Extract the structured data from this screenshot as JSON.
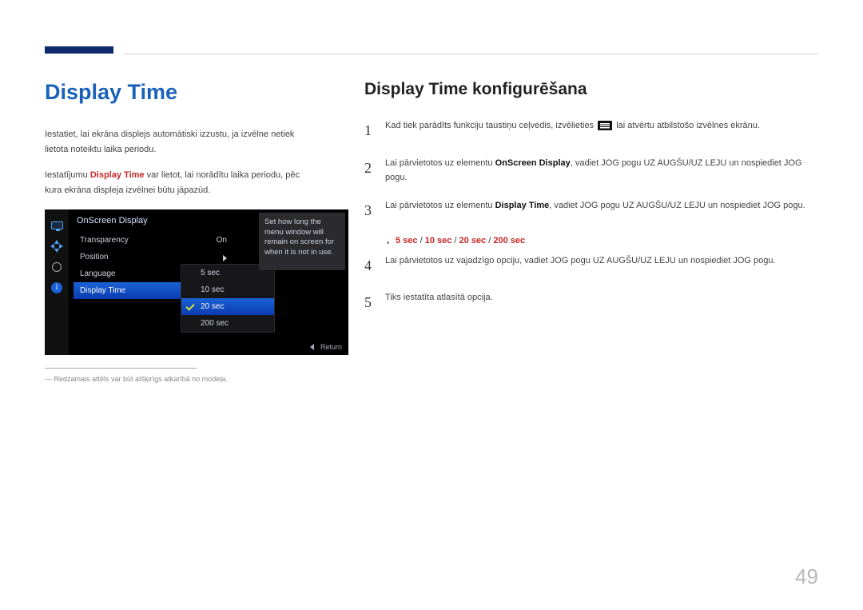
{
  "left": {
    "title": "Display Time",
    "para1": "Iestatiet, lai ekrāna displejs automātiski izzustu, ja izvēlne netiek lietota noteiktu laika periodu.",
    "para2_pre": "Iestatījumu ",
    "para2_strong": "Display Time",
    "para2_post": " var lietot, lai norādītu laika periodu, pēc kura ekrāna displeja izvēlnei būtu jāpazūd.",
    "note": "Redzamais attēls var būt atšķirīgs atkarībā no modeļa."
  },
  "osd": {
    "header": "OnScreen Display",
    "rows": [
      {
        "label": "Transparency",
        "value": "On",
        "caret": false,
        "sel": false
      },
      {
        "label": "Position",
        "value": "",
        "caret": true,
        "sel": false
      },
      {
        "label": "Language",
        "value": "",
        "caret": false,
        "sel": false
      },
      {
        "label": "Display Time",
        "value": "",
        "caret": false,
        "sel": true
      }
    ],
    "dropdown": [
      "5 sec",
      "10 sec",
      "20 sec",
      "200 sec"
    ],
    "dropdown_selected": 2,
    "desc": "Set how long the menu window will remain on screen for when it is not in use.",
    "return": "Return"
  },
  "right": {
    "subtitle": "Display Time konfigurēšana",
    "step1_pre": "Kad tiek parādīts funkciju taustiņu ceļvedis, izvēlieties ",
    "step1_post": " lai atvērtu atbilstošo izvēlnes ekrānu.",
    "step2_pre": "Lai pārvietotos uz elementu ",
    "step2_strong": "OnScreen Display",
    "step2_post": ", vadiet JOG pogu UZ AUGŠU/UZ LEJU un nospiediet JOG pogu.",
    "step3_pre": "Lai pārvietotos uz elementu ",
    "step3_strong": "Display Time",
    "step3_post": ", vadiet JOG pogu UZ AUGŠU/UZ LEJU un nospiediet JOG pogu.",
    "options_a": "5 sec",
    "options_b": "10 sec",
    "options_c": "20 sec",
    "options_d": "200 sec",
    "sep": " / ",
    "step4": "Lai pārvietotos uz vajadzīgo opciju, vadiet JOG pogu UZ AUGŠU/UZ LEJU un nospiediet JOG pogu.",
    "step5": "Tiks iestatīta atlasītā opcija."
  },
  "page_number": "49"
}
